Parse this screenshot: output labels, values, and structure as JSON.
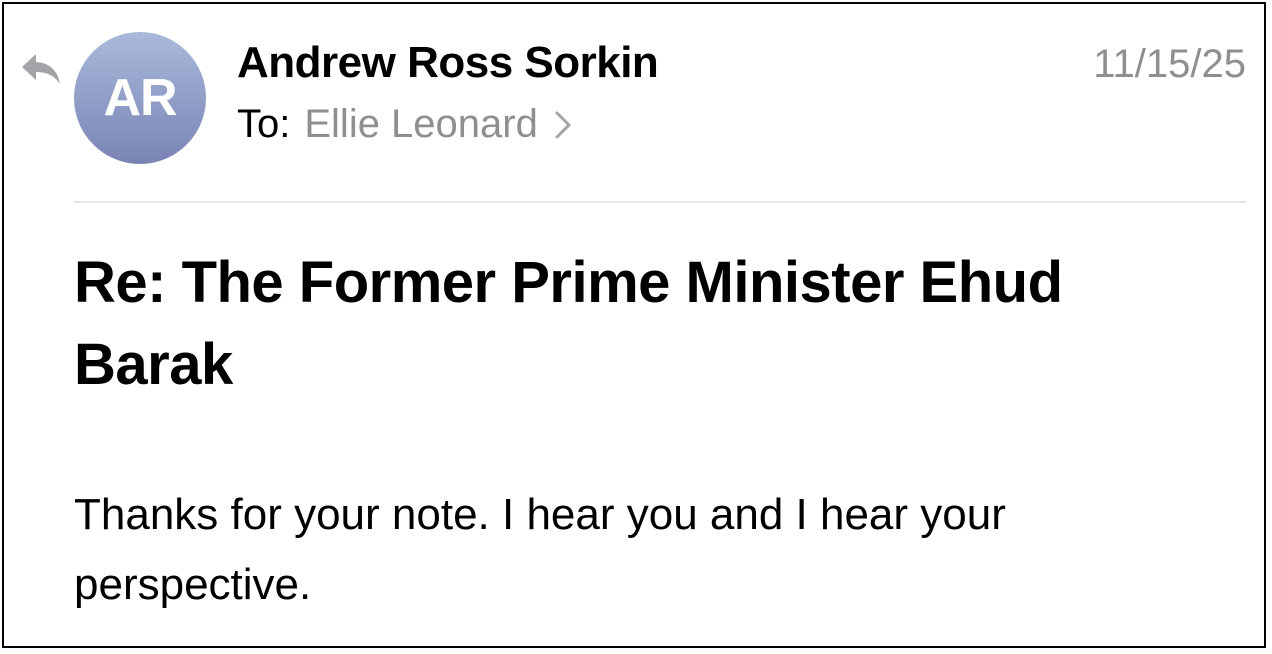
{
  "email": {
    "sender": {
      "name": "Andrew Ross Sorkin",
      "initials": "AR",
      "avatar_gradient_top": "#a9b9db",
      "avatar_gradient_bottom": "#7a84b5"
    },
    "to_label": "To:",
    "recipient": "Ellie Leonard",
    "date": "11/15/25",
    "subject": "Re: The Former Prime Minister Ehud Barak",
    "body": "Thanks for your note. I hear you and I hear your perspective."
  },
  "icons": {
    "reply": "reply-arrow-icon",
    "chevron": "chevron-right-icon"
  },
  "colors": {
    "secondary_text": "#8e8e93",
    "divider": "#e6e6e6",
    "icon_gray": "#a3a3a8"
  }
}
